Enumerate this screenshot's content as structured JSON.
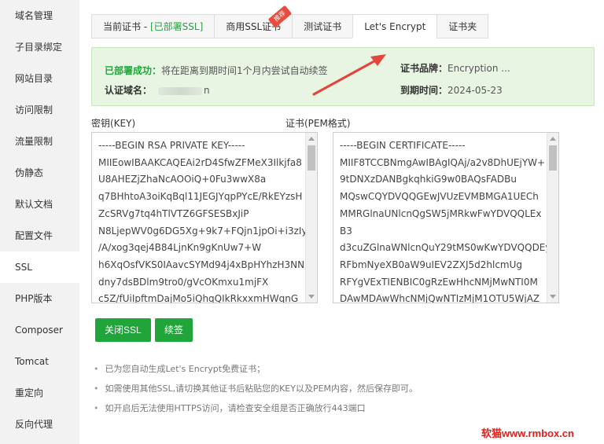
{
  "sidebar": {
    "items": [
      {
        "label": "域名管理"
      },
      {
        "label": "子目录绑定"
      },
      {
        "label": "网站目录"
      },
      {
        "label": "访问限制"
      },
      {
        "label": "流量限制"
      },
      {
        "label": "伪静态"
      },
      {
        "label": "默认文档"
      },
      {
        "label": "配置文件"
      },
      {
        "label": "SSL",
        "active": true
      },
      {
        "label": "PHP版本"
      },
      {
        "label": "Composer"
      },
      {
        "label": "Tomcat"
      },
      {
        "label": "重定向"
      },
      {
        "label": "反向代理"
      }
    ]
  },
  "tabs": {
    "current_prefix": "当前证书 - ",
    "current_status": "[已部署SSL]",
    "commercial": "商用SSL证书",
    "hot_badge": "推荐",
    "test": "测试证书",
    "letsencrypt": "Let's Encrypt",
    "folder": "证书夹"
  },
  "status": {
    "deployed_label": "已部署成功：",
    "deployed_text": "将在距离到期时间1个月内尝试自动续签",
    "domain_label": "认证域名：",
    "domain_suffix": "n",
    "brand_label": "证书品牌：",
    "brand_value": "Encryption ...",
    "expire_label": "到期时间：",
    "expire_value": "2024-05-23"
  },
  "key": {
    "label": "密钥(KEY)",
    "lines": [
      "-----BEGIN RSA PRIVATE KEY-----",
      "MIIEowIBAAKCAQEAi2rD4SfwZFMeX3Ilkjfa8",
      "U8AHEZjZhaNcAOOiQ+0Fu3wwX8a",
      "q7BHhtoA3oiKqBql11JEGJYqpPYcE/RkEYzsH",
      "ZcSRVg7tq4hTlVTZ6GFSESBxJiP",
      "N8LjepWV0g6DG5Xg+9k7+FQjn1jpOi+i3zIy",
      "/A/xog3qej4B84LjnKn9gKnUw7+W",
      "h6XqOsfVKS0IAavcSYMd94j4xBpHYhzH3NN",
      "dny7dsBDlm9tro0/gVcOKmxu1mjFX",
      "c5Z/fUiIpftmDajMo5iQhqQIkRkxxmHWqnG"
    ]
  },
  "cert": {
    "label": "证书(PEM格式)",
    "lines": [
      "-----BEGIN CERTIFICATE-----",
      "MIIF8TCCBNmgAwIBAgIQAj/a2v8DhUEjYW+",
      "9tDNXzDANBgkqhkiG9w0BAQsFADBu",
      "MQswCQYDVQQGEwJVUzEVMBMGA1UECh",
      "MMRGlnaUNlcnQgSW5jMRkwFwYDVQQLEx",
      "B3",
      "d3cuZGlnaWNlcnQuY29tMS0wKwYDVQQDEy",
      "RFbmNyeXB0aW9uIEV2ZXJ5d2hlcmUg",
      "RFYgVExTIENBIC0gRzEwHhcNMjMwNTI0M",
      "DAwMDAwWhcNMjQwNTIzMjM1OTU5WjAZ"
    ]
  },
  "buttons": {
    "close_ssl": "关闭SSL",
    "renew": "续签"
  },
  "notes": [
    "已为您自动生成Let's Encrypt免费证书；",
    "如需使用其他SSL,请切换其他证书后粘贴您的KEY以及PEM内容，然后保存即可。",
    "如开启后无法使用HTTPS访问，请检查安全组是否正确放行443端口"
  ],
  "watermark": "软猫www.rmbox.cn",
  "colors": {
    "accent": "#20a53a",
    "status_bg": "#e8f5e3",
    "arrow": "#e5443b",
    "watermark": "#e0201c"
  }
}
